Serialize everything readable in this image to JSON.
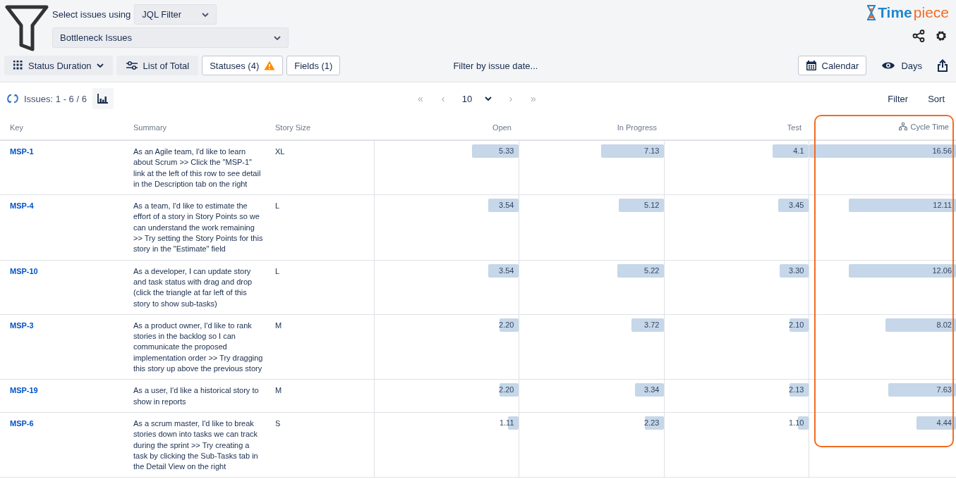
{
  "filter_panel": {
    "label": "Select issues using",
    "mode_select": "JQL Filter",
    "filter_select": "Bottleneck Issues"
  },
  "logo": {
    "text_main": "Time",
    "text_accent": "piece"
  },
  "toolbar": {
    "buttons": [
      {
        "kind": "dropdown",
        "label": "Status Duration",
        "warning": false
      },
      {
        "kind": "settings",
        "label": "List of Total",
        "warning": false
      },
      {
        "kind": "outlined",
        "label": "Statuses (4)",
        "warning": true
      },
      {
        "kind": "outlined",
        "label": "Fields (1)",
        "warning": false
      }
    ],
    "date_filter": "Filter by issue date...",
    "calendar": "Calendar",
    "view_mode": "Days"
  },
  "results": {
    "count": "Issues: 1 - 6 / 6",
    "pagination": [
      {
        "kind": "nav",
        "label": "«",
        "disabled": true
      },
      {
        "kind": "nav",
        "label": "‹",
        "disabled": true
      },
      {
        "kind": "size",
        "label": "10",
        "disabled": false
      },
      {
        "kind": "nav",
        "label": "›",
        "disabled": true
      },
      {
        "kind": "nav",
        "label": "»",
        "disabled": true
      }
    ],
    "filter": "Filter",
    "sort": "Sort"
  },
  "table": {
    "columns": [
      {
        "label": "Key",
        "kind": "key",
        "highlighted": false
      },
      {
        "label": "Summary",
        "kind": "text",
        "highlighted": false
      },
      {
        "label": "Story Size",
        "kind": "text",
        "highlighted": false
      },
      {
        "label": "Open",
        "kind": "duration",
        "highlighted": false
      },
      {
        "label": "In Progress",
        "kind": "duration",
        "highlighted": false
      },
      {
        "label": "Test",
        "kind": "duration",
        "highlighted": false
      },
      {
        "label": "Cycle Time",
        "kind": "total",
        "highlighted": true
      }
    ],
    "rows": [
      {
        "key": "MSP-1",
        "summary": "As an Agile team, I'd like to learn about Scrum >> Click the \"MSP-1\" link at the left of this row to see detail in the Description tab on the right",
        "story_size": "XL",
        "durations": [
          {
            "value": "5.33",
            "level": 0.32
          },
          {
            "value": "7.13",
            "level": 0.43
          },
          {
            "value": "4.1",
            "level": 0.25
          },
          {
            "value": "16.56",
            "level": 1.0
          }
        ]
      },
      {
        "key": "MSP-4",
        "summary": "As a team, I'd like to estimate the effort of a story in Story Points so we can understand the work remaining >> Try setting the Story Points for this story in the \"Estimate\" field",
        "story_size": "L",
        "durations": [
          {
            "value": "3.54",
            "level": 0.21
          },
          {
            "value": "5.12",
            "level": 0.31
          },
          {
            "value": "3.45",
            "level": 0.21
          },
          {
            "value": "12.11",
            "level": 0.73
          }
        ]
      },
      {
        "key": "MSP-10",
        "summary": "As a developer, I can update story and task status with drag and drop (click the triangle at far left of this story to show sub-tasks)",
        "story_size": "L",
        "durations": [
          {
            "value": "3.54",
            "level": 0.21
          },
          {
            "value": "5.22",
            "level": 0.32
          },
          {
            "value": "3.30",
            "level": 0.2
          },
          {
            "value": "12.06",
            "level": 0.73
          }
        ]
      },
      {
        "key": "MSP-3",
        "summary": "As a product owner, I'd like to rank stories in the backlog so I can communicate the proposed implementation order >> Try dragging this story up above the previous story",
        "story_size": "M",
        "durations": [
          {
            "value": "2.20",
            "level": 0.13
          },
          {
            "value": "3.72",
            "level": 0.22
          },
          {
            "value": "2.10",
            "level": 0.13
          },
          {
            "value": "8.02",
            "level": 0.48
          }
        ]
      },
      {
        "key": "MSP-19",
        "summary": "As a user, I'd like a historical story to show in reports",
        "story_size": "M",
        "durations": [
          {
            "value": "2.20",
            "level": 0.13
          },
          {
            "value": "3.34",
            "level": 0.2
          },
          {
            "value": "2.13",
            "level": 0.13
          },
          {
            "value": "7.63",
            "level": 0.46
          }
        ]
      },
      {
        "key": "MSP-6",
        "summary": "As a scrum master, I'd like to break stories down into tasks we can track during the sprint >> Try creating a task by clicking the Sub-Tasks tab in the Detail View on the right",
        "story_size": "S",
        "durations": [
          {
            "value": "1.11",
            "level": 0.07
          },
          {
            "value": "2.23",
            "level": 0.13
          },
          {
            "value": "1.10",
            "level": 0.07
          },
          {
            "value": "4.44",
            "level": 0.27
          }
        ]
      }
    ]
  }
}
